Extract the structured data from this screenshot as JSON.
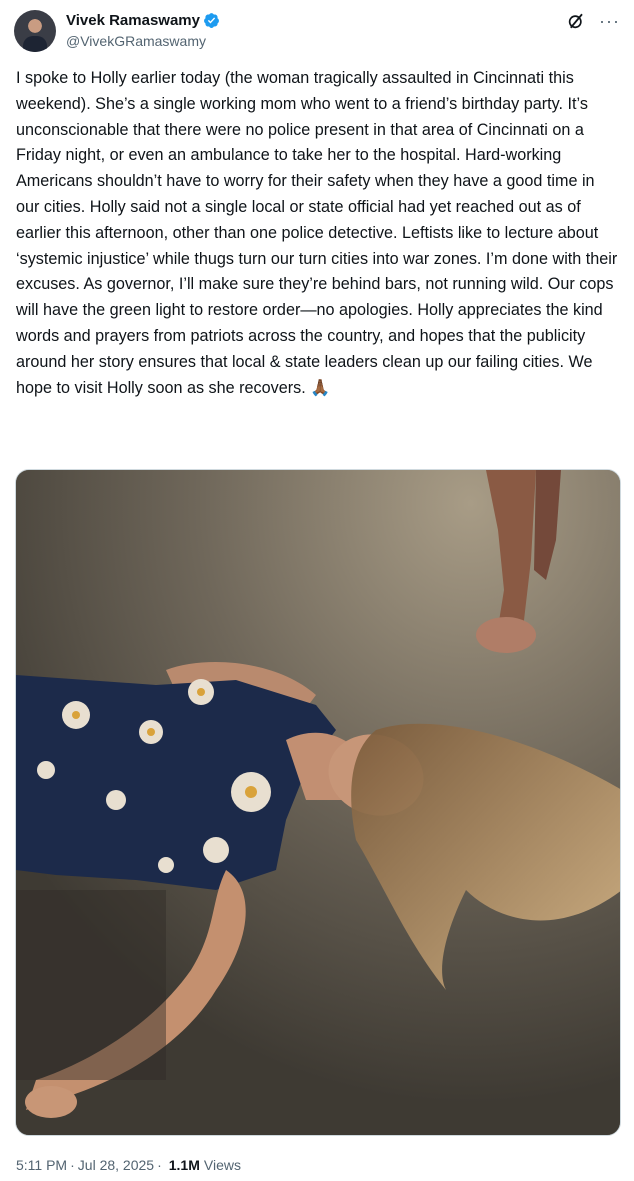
{
  "author": {
    "display_name": "Vivek Ramaswamy",
    "handle": "@VivekGRamaswamy",
    "verified": true,
    "avatar_icon": "profile-photo",
    "verified_color": "#1d9bf0"
  },
  "header": {
    "grok_icon": "grok-icon",
    "more_icon": "more-options-icon",
    "more_glyph": "···"
  },
  "tweet": {
    "text": "I spoke to Holly earlier today (the woman tragically assaulted in Cincinnati this weekend). She’s a single working mom who went to a friend’s birthday party. It’s unconscionable that there were no police present in that area of Cincinnati on a Friday night, or even an ambulance to take her to the hospital. Hard-working Americans shouldn’t have to worry for their safety when they have a good time in our cities. Holly said not a single local or state official had yet reached out as of earlier this afternoon, other than one police detective. Leftists like to lecture about ‘systemic injustice’ while thugs turn our turn cities into war zones. I’m done with their excuses. As governor, I’ll make sure they’re behind bars, not running wild. Our cops will have the green light to restore order—no apologies. Holly appreciates the kind words and prayers from patriots across the country, and hopes that the publicity around her story ensures that local & state leaders clean up our failing cities. We hope to visit Holly soon as she recovers. 🙏🏾"
  },
  "media": {
    "type": "photo",
    "icon": "attached-photo"
  },
  "meta": {
    "time": "5:11 PM",
    "date": "Jul 28, 2025",
    "separator": "·",
    "views_count": "1.1M",
    "views_label": "Views"
  },
  "colors": {
    "text": "#0f1419",
    "secondary": "#536471",
    "border": "#cfd9de",
    "accent": "#1d9bf0"
  }
}
